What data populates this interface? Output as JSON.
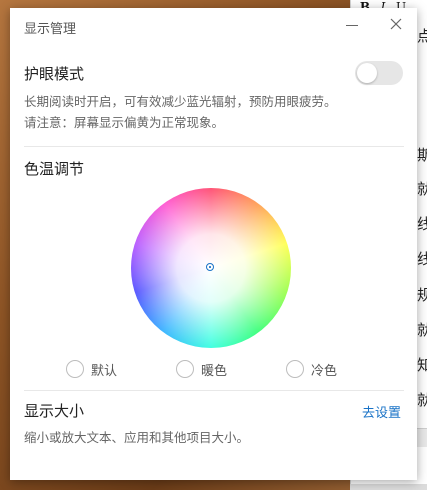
{
  "background_editor": {
    "toolbar": [
      "B",
      "I",
      "U"
    ],
    "line_fragments": [
      "点",
      "斯",
      "就",
      "线",
      "线",
      "规",
      "就",
      "知",
      "就"
    ]
  },
  "dialog": {
    "title": "显示管理",
    "eye_protection": {
      "label": "护眼模式",
      "enabled": false,
      "description_line1": "长期阅读时开启，可有效减少蓝光辐射，预防用眼疲劳。",
      "description_line2": "请注意：屏幕显示偏黄为正常现象。"
    },
    "color_temperature": {
      "label": "色温调节",
      "options": [
        {
          "label": "默认",
          "selected": false
        },
        {
          "label": "暖色",
          "selected": false
        },
        {
          "label": "冷色",
          "selected": false
        }
      ]
    },
    "display_size": {
      "label": "显示大小",
      "link": "去设置",
      "description": "缩小或放大文本、应用和其他项目大小。"
    }
  },
  "colors": {
    "accent": "#1a73c7",
    "toggle_off": "#e6e6e6",
    "title_text": "#555555"
  }
}
